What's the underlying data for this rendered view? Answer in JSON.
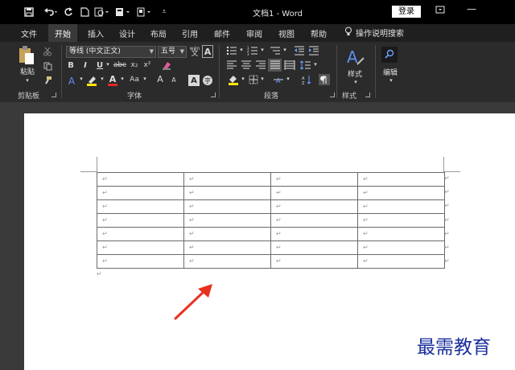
{
  "title_bar": {
    "save_icon": "save-icon",
    "undo_icon": "undo-icon",
    "redo_icon": "redo-icon",
    "new_icon": "new-doc-icon",
    "doc_title": "文档1  -  Word",
    "sign_in": "登录",
    "ribbon_display_icon": "ribbon-display-icon",
    "minimize_icon": "minimize-icon"
  },
  "tabs": [
    "文件",
    "开始",
    "插入",
    "设计",
    "布局",
    "引用",
    "邮件",
    "审阅",
    "视图",
    "帮助"
  ],
  "active_tab": "开始",
  "tell_me": "操作说明搜索",
  "ribbon": {
    "clipboard": {
      "paste": "粘贴",
      "label": "剪贴板"
    },
    "font": {
      "font_name": "等线 (中文正文)",
      "font_size": "五号",
      "bold": "B",
      "italic": "I",
      "underline": "U",
      "strike": "abc",
      "subscript": "x₂",
      "superscript": "x²",
      "change_case": "Aa",
      "grow": "A",
      "shrink": "A",
      "label": "字体"
    },
    "paragraph": {
      "label": "段落"
    },
    "styles": {
      "button": "样式",
      "label": "样式"
    },
    "editing": {
      "button": "编辑"
    }
  },
  "document": {
    "table": {
      "rows": 7,
      "cols": 4,
      "cell_mark": "↵"
    },
    "para_mark": "↵"
  },
  "watermark": "最需教育",
  "colors": {
    "titlebar_bg": "#000000",
    "ribbon_bg": "#2b2b2b",
    "arrow": "#e8321e",
    "watermark": "#1a2e9c"
  }
}
